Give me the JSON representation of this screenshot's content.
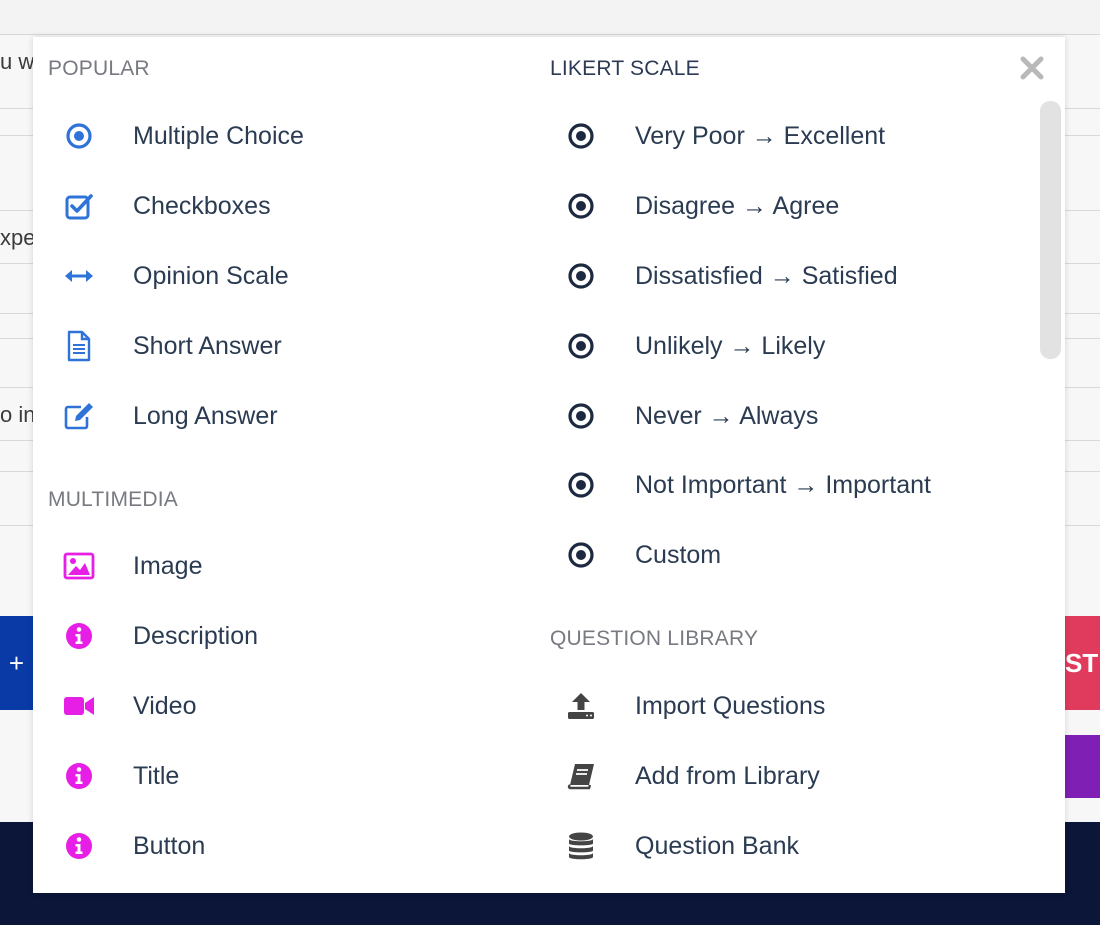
{
  "background": {
    "snippets": [
      "u w",
      "xpe",
      "o in"
    ],
    "left_button_label": "+",
    "right_button_label": "STI"
  },
  "modal": {
    "close_icon": "close-icon",
    "popular": {
      "title": "POPULAR",
      "items": [
        {
          "label": "Multiple Choice",
          "icon": "radio-dot-icon"
        },
        {
          "label": "Checkboxes",
          "icon": "checkbox-icon"
        },
        {
          "label": "Opinion Scale",
          "icon": "double-arrow-icon"
        },
        {
          "label": "Short Answer",
          "icon": "document-icon"
        },
        {
          "label": "Long Answer",
          "icon": "edit-icon"
        }
      ]
    },
    "multimedia": {
      "title": "MULTIMEDIA",
      "items": [
        {
          "label": "Image",
          "icon": "image-icon"
        },
        {
          "label": "Description",
          "icon": "info-icon"
        },
        {
          "label": "Video",
          "icon": "video-camera-icon"
        },
        {
          "label": "Title",
          "icon": "info-icon"
        },
        {
          "label": "Button",
          "icon": "info-icon"
        }
      ]
    },
    "likert": {
      "title": "LIKERT SCALE",
      "items": [
        {
          "label": "Very Poor → Excellent"
        },
        {
          "label": "Disagree → Agree"
        },
        {
          "label": "Dissatisfied → Satisfied"
        },
        {
          "label": "Unlikely → Likely"
        },
        {
          "label": "Never → Always"
        },
        {
          "label": "Not Important → Important"
        },
        {
          "label": "Custom"
        }
      ]
    },
    "library": {
      "title": "QUESTION LIBRARY",
      "items": [
        {
          "label": "Import Questions",
          "icon": "upload-icon"
        },
        {
          "label": "Add from Library",
          "icon": "book-icon"
        },
        {
          "label": "Question Bank",
          "icon": "database-icon"
        }
      ]
    }
  },
  "colors": {
    "popular_icon": "#2f73d8",
    "multimedia_icon": "#e61ee6",
    "likert_icon": "#1d2940",
    "library_icon": "#444444"
  }
}
